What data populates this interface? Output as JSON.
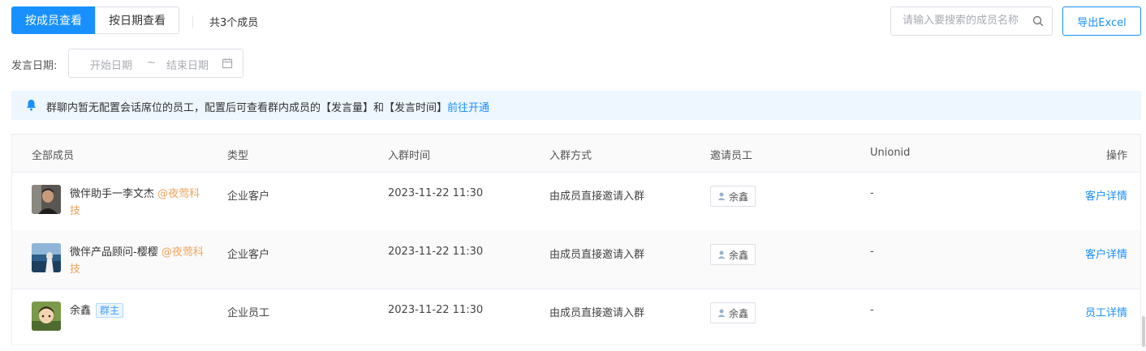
{
  "toolbar": {
    "view_by_member": "按成员查看",
    "view_by_date": "按日期查看",
    "member_count": "共3个成员",
    "search_placeholder": "请输入要搜索的成员名称",
    "export_label": "导出Excel",
    "active_color": "#1890ff"
  },
  "date_filter": {
    "label": "发言日期:",
    "start_placeholder": "开始日期",
    "separator": "~",
    "end_placeholder": "结束日期"
  },
  "notice": {
    "text": "群聊内暂无配置会话席位的员工，配置后可查看群内成员的【发言量】和【发言时间】",
    "link": "前往开通",
    "background": "#eef6ff"
  },
  "table": {
    "columns": [
      "全部成员",
      "类型",
      "入群时间",
      "入群方式",
      "邀请员工",
      "Unionid",
      "操作"
    ],
    "rows": [
      {
        "name": "微伴助手一李文杰",
        "corp": "@夜莺科技",
        "owner_tag": "",
        "type": "企业客户",
        "join_time": "2023-11-22 11:30",
        "join_method": "由成员直接邀请入群",
        "inviter": "余鑫",
        "unionid": "-",
        "action": "客户详情"
      },
      {
        "name": "微伴产品顾问-樱樱",
        "corp": "@夜莺科技",
        "owner_tag": "",
        "type": "企业客户",
        "join_time": "2023-11-22 11:30",
        "join_method": "由成员直接邀请入群",
        "inviter": "余鑫",
        "unionid": "-",
        "action": "客户详情"
      },
      {
        "name": "余鑫",
        "corp": "",
        "owner_tag": "群主",
        "type": "企业员工",
        "join_time": "2023-11-22 11:30",
        "join_method": "由成员直接邀请入群",
        "inviter": "余鑫",
        "unionid": "-",
        "action": "员工详情"
      }
    ]
  }
}
